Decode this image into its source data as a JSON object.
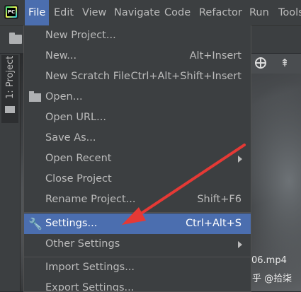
{
  "menubar": {
    "items": [
      {
        "label": "File",
        "active": true
      },
      {
        "label": "Edit"
      },
      {
        "label": "View"
      },
      {
        "label": "Navigate"
      },
      {
        "label": "Code"
      },
      {
        "label": "Refactor"
      },
      {
        "label": "Run"
      },
      {
        "label": "Tools"
      }
    ]
  },
  "left_stripe": {
    "project_tab_label": "1: Project"
  },
  "file_menu": {
    "items": [
      {
        "label": "New Project...",
        "shortcut": ""
      },
      {
        "label": "New...",
        "shortcut": "Alt+Insert"
      },
      {
        "label": "New Scratch File",
        "shortcut": "Ctrl+Alt+Shift+Insert"
      },
      {
        "label": "Open...",
        "shortcut": "",
        "icon": "folder-open-icon"
      },
      {
        "label": "Open URL...",
        "shortcut": ""
      },
      {
        "label": "Save As...",
        "shortcut": ""
      },
      {
        "label": "Open Recent",
        "shortcut": "",
        "submenu": true
      },
      {
        "label": "Close Project",
        "shortcut": ""
      },
      {
        "label": "Rename Project...",
        "shortcut": "Shift+F6"
      },
      {
        "label": "Settings...",
        "shortcut": "Ctrl+Alt+S",
        "icon": "wrench-icon",
        "highlighted": true
      },
      {
        "label": "Other Settings",
        "shortcut": "",
        "submenu": true
      },
      {
        "label": "Import Settings...",
        "shortcut": ""
      },
      {
        "label": "Export Settings...",
        "shortcut": ""
      }
    ]
  },
  "background": {
    "file_label": "06.mp4",
    "watermark": "知乎 @拾柒"
  },
  "colors": {
    "menu_bg": "#3c3f41",
    "highlight": "#4b6eaf",
    "text": "#bbbbbb",
    "annotation_arrow": "#e53935"
  }
}
